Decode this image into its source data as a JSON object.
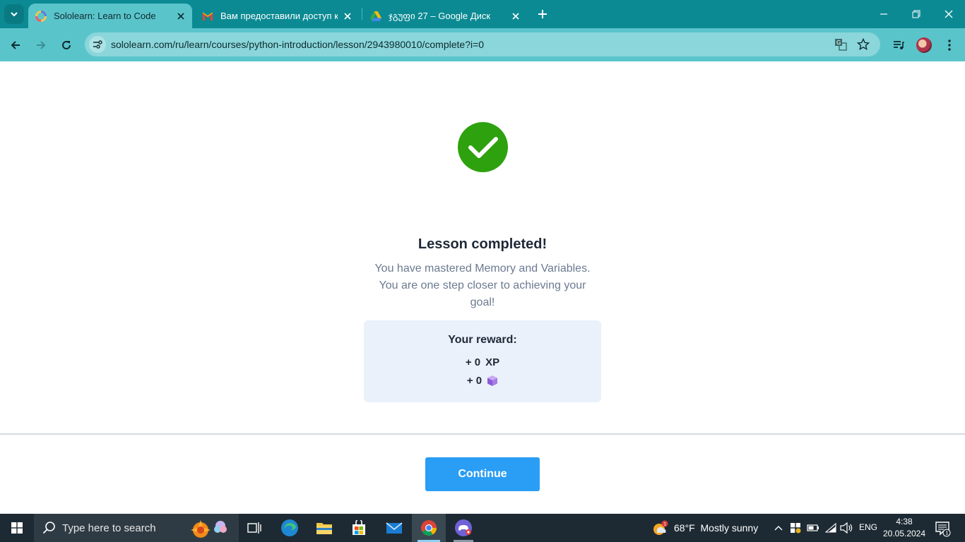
{
  "browser": {
    "tabs": [
      {
        "title": "Sololearn: Learn to Code",
        "active": true,
        "favicon": "sololearn-icon"
      },
      {
        "title": "Вам предоставили доступ к па",
        "active": false,
        "favicon": "gmail-icon"
      },
      {
        "title": "ჯგუფი 27 – Google Диск",
        "active": false,
        "favicon": "google-drive-icon"
      }
    ],
    "url": "sololearn.com/ru/learn/courses/python-introduction/lesson/2943980010/complete?i=0"
  },
  "lesson": {
    "heading": "Lesson completed!",
    "message": "You have mastered Memory and Variables. You are one step closer to achieving your goal!",
    "reward": {
      "title": "Your reward:",
      "xp_amount": "+ 0",
      "xp_label": "XP",
      "bits_amount": "+ 0",
      "bits_icon": "cube-icon"
    },
    "continue_label": "Continue"
  },
  "taskbar": {
    "search_placeholder": "Type here to search",
    "weather": {
      "temp": "68°F",
      "condition": "Mostly sunny",
      "badge": "1"
    },
    "language": "ENG",
    "time": "4:38",
    "date": "20.05.2024",
    "notification_count": "1"
  },
  "colors": {
    "chrome_tabstrip": "#0b8a93",
    "chrome_toolbar": "#5ac4cb",
    "success_green": "#2ea10e",
    "continue_blue": "#2a9df4",
    "reward_bg": "#eaf1fb",
    "taskbar_bg": "#1d2a33"
  }
}
